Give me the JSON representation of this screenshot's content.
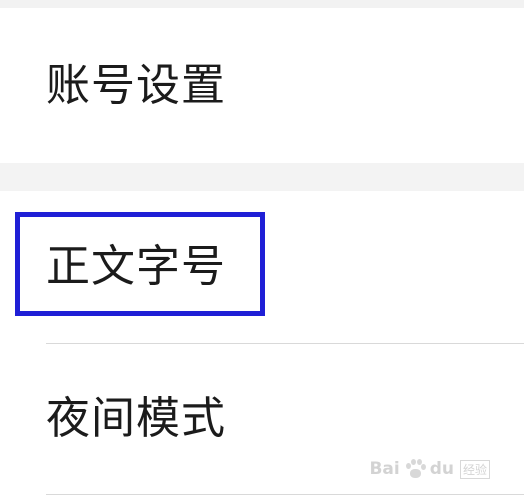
{
  "settings": {
    "items": [
      {
        "label": "账号设置"
      },
      {
        "label": "正文字号"
      },
      {
        "label": "夜间模式"
      }
    ]
  },
  "highlight": {
    "color": "#1f1fd6"
  },
  "watermark": {
    "icon": "baidu-paw-icon",
    "brand": "Bai",
    "suffix": "du",
    "sub": "经验"
  }
}
